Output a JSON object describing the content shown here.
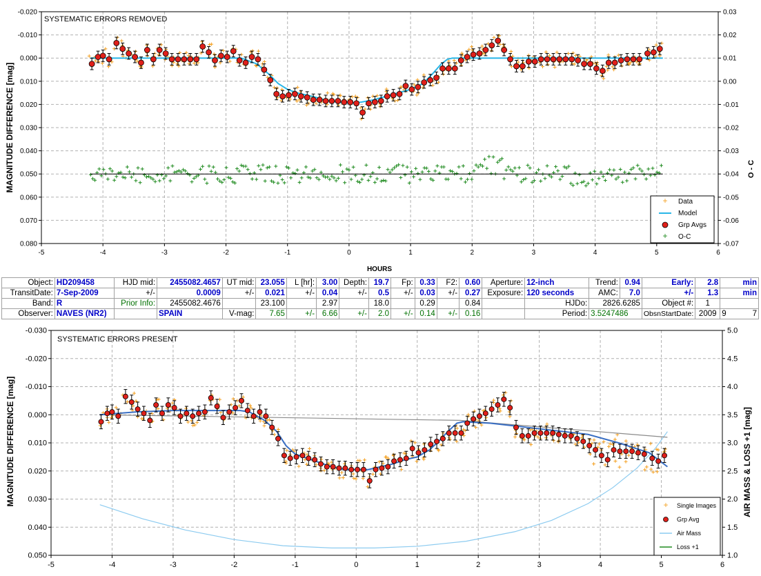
{
  "colors": {
    "data": "#f4a020",
    "model": "#29b6e8",
    "grp": "#e0201a",
    "oc": "#1e8a1e",
    "fit_bottom": "#3a6fc4",
    "trend_line": "#8a8a8a",
    "airmass": "#8ccbf0",
    "loss": "#1e8a1e",
    "grid": "#b0b0b0"
  },
  "chart_data": [
    {
      "type": "scatter",
      "title": "SYSTEMATIC ERRORS REMOVED",
      "xlabel": "HOURS",
      "ylabel": "MAGNITUDE DIFFERENCE [mag]",
      "y2label": "O - C",
      "xlim": [
        -5,
        6
      ],
      "ylim": [
        -0.02,
        0.08
      ],
      "y2lim": [
        -0.07,
        0.03
      ],
      "x_ticks": [
        "-5",
        "-4",
        "-3",
        "-2",
        "-1",
        "0",
        "1",
        "2",
        "3",
        "4",
        "5",
        "6"
      ],
      "y_ticks": [
        "-0.020",
        "-0.010",
        "0.000",
        "0.010",
        "0.020",
        "0.030",
        "0.040",
        "0.050",
        "0.060",
        "0.070",
        "0.080"
      ],
      "y2_ticks": [
        "-0.07",
        "-0.06",
        "-0.05",
        "-0.04",
        "-0.03",
        "-0.02",
        "-0.01",
        "0.00",
        "0.01",
        "0.02",
        "0.03"
      ],
      "y_inverted": true,
      "grid": true,
      "legend_position": "bottom-right",
      "legend": [
        "Data",
        "Model",
        "Grp Avgs",
        "O-C"
      ],
      "oc_baseline": 0.05,
      "model": {
        "x": [
          -4.2,
          -1.75,
          -1.5,
          -1.3,
          -1.15,
          -1.0,
          -0.85,
          -0.6,
          -0.4,
          -0.2,
          0.0,
          0.2,
          0.4,
          0.6,
          0.8,
          1.0,
          1.2,
          1.35,
          1.5,
          1.6,
          1.68,
          1.75,
          5.1
        ],
        "y": [
          0.0,
          0.0,
          0.0025,
          0.007,
          0.011,
          0.0135,
          0.015,
          0.0165,
          0.018,
          0.019,
          0.0195,
          0.019,
          0.018,
          0.0165,
          0.015,
          0.0135,
          0.011,
          0.007,
          0.0025,
          0.0005,
          0.0,
          0.0,
          0.0
        ]
      },
      "grp_avgs": {
        "x": [
          -4.18,
          -4.08,
          -4.0,
          -3.9,
          -3.78,
          -3.68,
          -3.58,
          -3.48,
          -3.38,
          -3.28,
          -3.18,
          -3.08,
          -2.98,
          -2.88,
          -2.78,
          -2.68,
          -2.58,
          -2.48,
          -2.38,
          -2.28,
          -2.18,
          -2.08,
          -1.98,
          -1.88,
          -1.78,
          -1.68,
          -1.58,
          -1.48,
          -1.38,
          -1.28,
          -1.18,
          -1.08,
          -0.98,
          -0.88,
          -0.78,
          -0.68,
          -0.58,
          -0.48,
          -0.38,
          -0.28,
          -0.18,
          -0.08,
          0.02,
          0.12,
          0.22,
          0.32,
          0.42,
          0.52,
          0.62,
          0.72,
          0.82,
          0.92,
          1.02,
          1.12,
          1.22,
          1.32,
          1.42,
          1.52,
          1.62,
          1.72,
          1.82,
          1.92,
          2.02,
          2.12,
          2.22,
          2.32,
          2.42,
          2.52,
          2.62,
          2.72,
          2.82,
          2.92,
          3.02,
          3.12,
          3.22,
          3.32,
          3.42,
          3.52,
          3.62,
          3.72,
          3.82,
          3.92,
          4.02,
          4.12,
          4.22,
          4.32,
          4.42,
          4.52,
          4.62,
          4.72,
          4.85,
          4.95,
          5.05
        ],
        "y": [
          0.0025,
          -0.0005,
          -0.001,
          0.0005,
          -0.0065,
          -0.004,
          -0.002,
          -0.0005,
          0.002,
          -0.0035,
          0.0005,
          -0.0035,
          -0.002,
          0.0005,
          0.0005,
          0.0005,
          0.0005,
          0.0005,
          -0.005,
          -0.0025,
          0.001,
          -0.001,
          -0.0005,
          -0.003,
          0.001,
          0.002,
          -0.0005,
          0.0005,
          0.005,
          0.0095,
          0.0155,
          0.0165,
          0.016,
          0.0155,
          0.0165,
          0.017,
          0.018,
          0.018,
          0.0185,
          0.0185,
          0.0185,
          0.019,
          0.019,
          0.0195,
          0.0235,
          0.0195,
          0.019,
          0.0185,
          0.0165,
          0.016,
          0.0155,
          0.012,
          0.0135,
          0.0125,
          0.0105,
          0.0095,
          0.0085,
          0.0045,
          0.0045,
          0.0045,
          0.001,
          -0.0005,
          -0.0015,
          -0.002,
          -0.0035,
          -0.0055,
          -0.0075,
          -0.0035,
          0.0005,
          0.0035,
          0.0035,
          0.0015,
          0.0015,
          0.0005,
          0.0005,
          0.0005,
          0.0005,
          0.0005,
          0.0005,
          0.001,
          0.0025,
          0.0025,
          0.0045,
          0.0055,
          0.002,
          0.002,
          0.001,
          0.0005,
          0.0005,
          0.0005,
          -0.002,
          -0.0025,
          -0.004
        ],
        "err": 0.0025
      }
    },
    {
      "type": "scatter",
      "title": "SYSTEMATIC ERRORS PRESENT",
      "xlabel": "",
      "ylabel": "MAGNITUDE DIFFERENCE [mag]",
      "y2label": "AIR MASS & LOSS +1 [mag]",
      "xlim": [
        -5,
        6
      ],
      "ylim": [
        -0.03,
        0.05
      ],
      "y2lim": [
        1.0,
        5.0
      ],
      "x_ticks": [
        "-5",
        "-4",
        "-3",
        "-2",
        "-1",
        "0",
        "1",
        "2",
        "3",
        "4",
        "5",
        "6"
      ],
      "y_ticks": [
        "-0.030",
        "-0.020",
        "-0.010",
        "0.000",
        "0.010",
        "0.020",
        "0.030",
        "0.040",
        "0.050"
      ],
      "y2_ticks": [
        "1.0",
        "1.5",
        "2.0",
        "2.5",
        "3.0",
        "3.5",
        "4.0",
        "4.5",
        "5.0"
      ],
      "y_inverted": true,
      "grid": true,
      "legend_position": "bottom-right",
      "legend": [
        "Single Images",
        "Grp Avg",
        "Air Mass",
        "Loss +1"
      ],
      "trend_line": {
        "x": [
          -4.2,
          1.7,
          5.1
        ],
        "y": [
          0.0,
          0.002,
          0.008
        ]
      },
      "fit_line": {
        "x": [
          -4.2,
          -3.6,
          -3.0,
          -2.4,
          -1.9,
          -1.75,
          -1.5,
          -1.3,
          -1.15,
          -1.0,
          -0.8,
          -0.6,
          -0.4,
          -0.2,
          0.0,
          0.2,
          0.4,
          0.6,
          0.8,
          1.0,
          1.2,
          1.35,
          1.5,
          1.65,
          1.75,
          2.2,
          2.6,
          3.2,
          3.8,
          4.3,
          4.8,
          5.1
        ],
        "y": [
          0.0,
          -0.001,
          -0.0015,
          -0.0015,
          -0.0015,
          -0.001,
          0.002,
          0.006,
          0.011,
          0.014,
          0.0155,
          0.017,
          0.0185,
          0.0195,
          0.0195,
          0.0195,
          0.0185,
          0.0175,
          0.016,
          0.015,
          0.0125,
          0.0095,
          0.006,
          0.003,
          0.0025,
          0.003,
          0.004,
          0.0055,
          0.007,
          0.01,
          0.0135,
          0.0185
        ]
      },
      "airmass": {
        "x": [
          -4.2,
          -3.5,
          -2.8,
          -2.0,
          -1.2,
          -0.4,
          0.3,
          1.0,
          1.8,
          2.6,
          3.2,
          3.8,
          4.2,
          4.6,
          4.9,
          5.1
        ],
        "y": [
          1.9,
          1.65,
          1.45,
          1.28,
          1.17,
          1.13,
          1.13,
          1.16,
          1.25,
          1.42,
          1.62,
          1.92,
          2.2,
          2.55,
          2.9,
          3.2
        ]
      },
      "grp_avg": {
        "x": [
          -4.18,
          -4.08,
          -4.0,
          -3.9,
          -3.78,
          -3.68,
          -3.58,
          -3.48,
          -3.38,
          -3.28,
          -3.18,
          -3.08,
          -2.98,
          -2.88,
          -2.78,
          -2.68,
          -2.58,
          -2.48,
          -2.38,
          -2.28,
          -2.18,
          -2.08,
          -1.98,
          -1.88,
          -1.78,
          -1.68,
          -1.58,
          -1.48,
          -1.38,
          -1.28,
          -1.18,
          -1.08,
          -0.98,
          -0.88,
          -0.78,
          -0.68,
          -0.58,
          -0.48,
          -0.38,
          -0.28,
          -0.18,
          -0.08,
          0.02,
          0.12,
          0.22,
          0.32,
          0.42,
          0.52,
          0.62,
          0.72,
          0.82,
          0.92,
          1.02,
          1.12,
          1.22,
          1.32,
          1.42,
          1.52,
          1.62,
          1.72,
          1.82,
          1.92,
          2.02,
          2.12,
          2.22,
          2.32,
          2.42,
          2.52,
          2.62,
          2.72,
          2.82,
          2.92,
          3.02,
          3.12,
          3.22,
          3.32,
          3.42,
          3.52,
          3.62,
          3.72,
          3.82,
          3.92,
          4.02,
          4.12,
          4.22,
          4.32,
          4.42,
          4.52,
          4.62,
          4.72,
          4.85,
          4.95,
          5.05
        ],
        "y": [
          0.0025,
          -0.0005,
          -0.001,
          0.0005,
          -0.0065,
          -0.0045,
          -0.002,
          -0.0005,
          0.002,
          -0.0035,
          -0.0005,
          -0.0035,
          -0.0025,
          0.0005,
          -0.0005,
          0.0005,
          -0.0005,
          -0.001,
          -0.006,
          -0.003,
          0.001,
          -0.001,
          -0.0025,
          -0.005,
          -0.0015,
          0.0005,
          -0.001,
          0.0005,
          0.0045,
          0.0085,
          0.0145,
          0.0155,
          0.015,
          0.0145,
          0.0155,
          0.016,
          0.0175,
          0.0185,
          0.0185,
          0.019,
          0.019,
          0.0195,
          0.0195,
          0.0195,
          0.0235,
          0.0195,
          0.019,
          0.0185,
          0.0165,
          0.016,
          0.0155,
          0.012,
          0.0135,
          0.0125,
          0.0105,
          0.0095,
          0.0085,
          0.0065,
          0.0065,
          0.0065,
          0.003,
          0.0015,
          0.0005,
          -0.0005,
          -0.002,
          -0.0035,
          -0.0055,
          -0.0025,
          0.0045,
          0.0075,
          0.0075,
          0.0065,
          0.0065,
          0.0065,
          0.0065,
          0.007,
          0.0075,
          0.0075,
          0.0085,
          0.0095,
          0.011,
          0.0125,
          0.0145,
          0.016,
          0.0125,
          0.013,
          0.013,
          0.013,
          0.0135,
          0.014,
          0.0155,
          0.0165,
          0.0145
        ],
        "err": 0.0025
      }
    }
  ],
  "info_table": {
    "row1": {
      "object_label": "Object:",
      "object": "HD209458",
      "hjd_mid_label": "HJD mid:",
      "hjd_mid": "2455082.4657",
      "ut_mid_label": "UT mid:",
      "ut_mid": "23.055",
      "l_hr_label": "L [hr]:",
      "l_hr": "3.00",
      "depth_label": "Depth:",
      "depth": "19.7",
      "fp_label": "Fp:",
      "fp": "0.33",
      "f2_label": "F2:",
      "f2": "0.60",
      "aperture_label": "Aperture:",
      "aperture": "12-inch",
      "trend_label": "Trend:",
      "trend": "0.94",
      "early_label": "Early:",
      "early": "2.8",
      "early_unit": "min"
    },
    "row2": {
      "transit_date_label": "TransitDate:",
      "transit_date": "7-Sep-2009",
      "pm1": "+/-",
      "hjd_err": "0.0009",
      "pm2": "+/-",
      "ut_err": "0.021",
      "pm3": "+/-",
      "l_err": "0.04",
      "pm4": "+/-",
      "depth_err": "0.5",
      "pm5": "+/-",
      "fp_err": "0.03",
      "pm6": "+/-",
      "f2_err": "0.27",
      "exposure_label": "Exposure:",
      "exposure": "120 seconds",
      "amc_label": "AMC:",
      "amc": "7.0",
      "pm7": "+/-",
      "early_err": "1.3",
      "early_err_unit": "min"
    },
    "row3": {
      "band_label": "Band:",
      "band": "R",
      "prior_label": "Prior Info:",
      "prior_hjd": "2455082.4676",
      "prior_ut": "23.100",
      "prior_l": "2.97",
      "prior_depth": "18.0",
      "prior_fp": "0.29",
      "prior_f2": "0.84",
      "hjdo_label": "HJDo:",
      "hjdo": "2826.6285",
      "object_num_label": "Object #:",
      "object_num": "1"
    },
    "row4": {
      "observer_label": "Observer:",
      "observer": "NAVES (NR2)",
      "location": "SPAIN",
      "vmag_label": "V-mag:",
      "vmag": "7.65",
      "pm8": "+/-",
      "v2": "6.66",
      "pm9": "+/-",
      "v3": "2.0",
      "pm10": "+/-",
      "v4": "0.14",
      "pm11": "+/-",
      "v5": "0.16",
      "period_label": "Period:",
      "period": "3.5247486",
      "obsn_label": "ObsnStartDate:",
      "obsn_year": "2009",
      "obsn_month": "9",
      "obsn_day": "7"
    }
  }
}
